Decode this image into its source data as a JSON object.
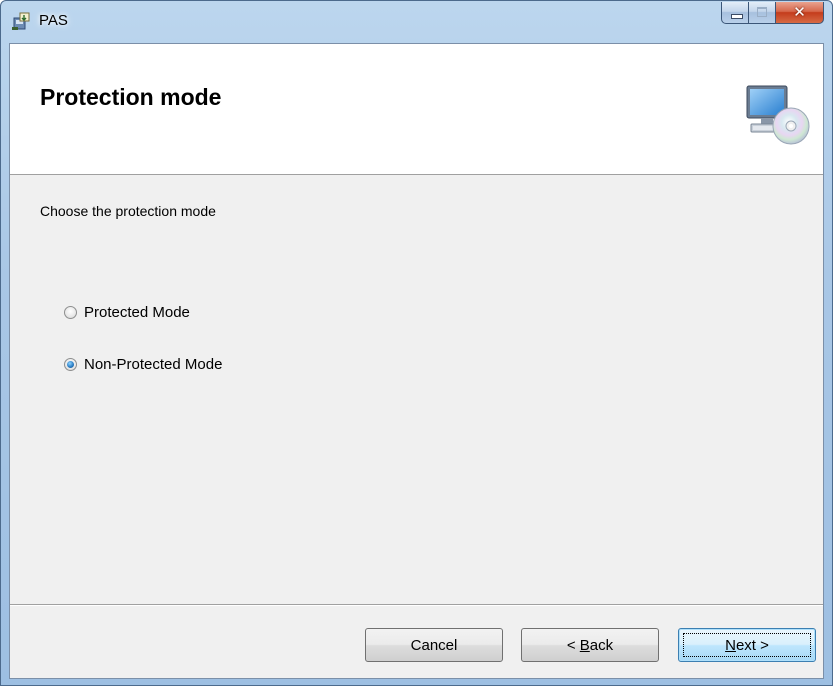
{
  "window": {
    "title": "PAS",
    "icons": {
      "app": "installer-package-icon",
      "minimize": "minimize-icon",
      "maximize": "maximize-icon",
      "close": "close-icon",
      "banner": "computer-with-disc-icon"
    }
  },
  "banner": {
    "title": "Protection mode"
  },
  "content": {
    "instruction": "Choose the protection mode",
    "options": [
      {
        "label": "Protected Mode",
        "checked": false
      },
      {
        "label": "Non-Protected Mode",
        "checked": true
      }
    ]
  },
  "buttons": {
    "cancel": "Cancel",
    "back_prefix": "< ",
    "back_mnemonic": "B",
    "back_rest": "ack",
    "next_mnemonic": "N",
    "next_rest": "ext >"
  },
  "colors": {
    "title_bar": "#a9c7e6",
    "close_button": "#c43c1c",
    "dialog_background": "#f0f0f0",
    "banner_background": "#ffffff",
    "default_button_border": "#3c7fb1"
  }
}
